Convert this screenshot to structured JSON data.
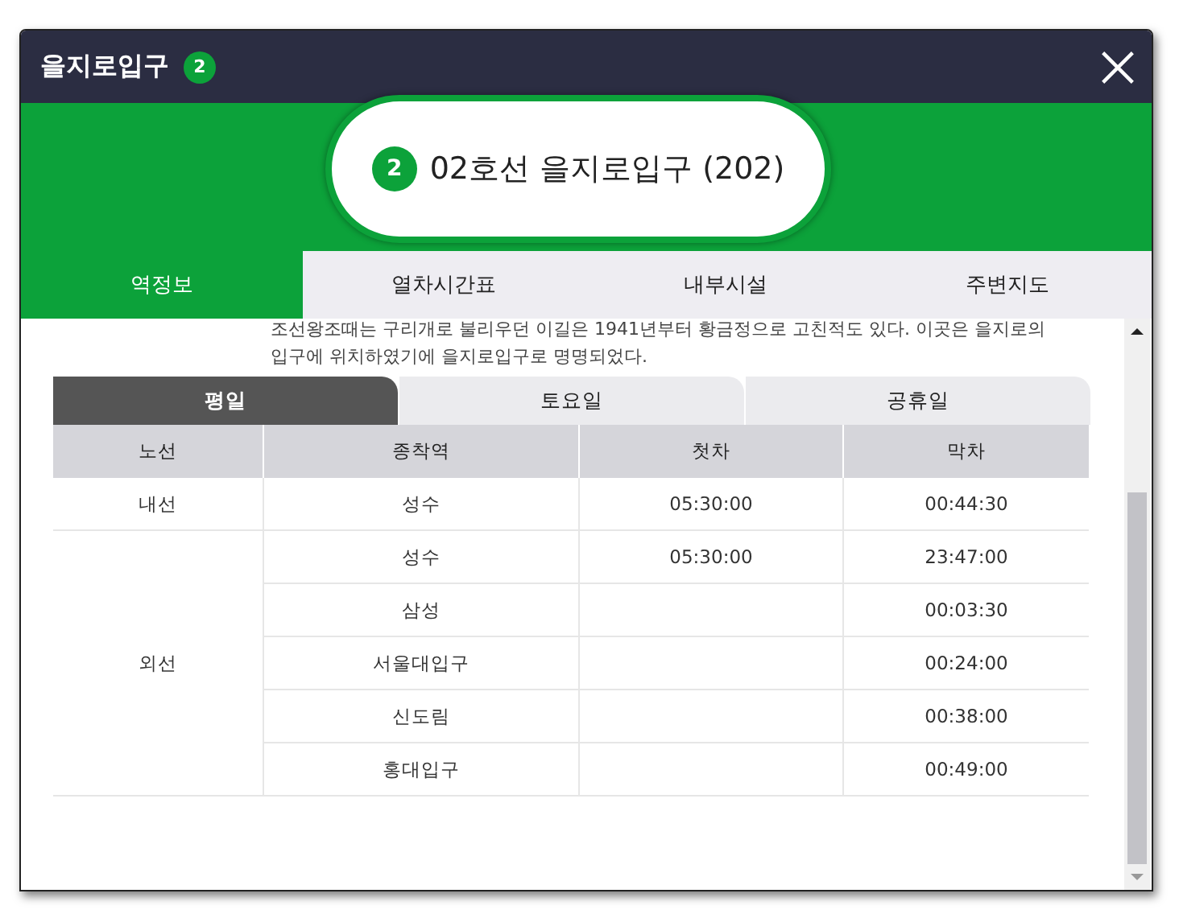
{
  "window": {
    "title": "을지로입구",
    "line_badge": "2"
  },
  "station": {
    "line_badge": "2",
    "name": "02호선 을지로입구 (202)"
  },
  "tabs": [
    {
      "label": "역정보",
      "selected": true
    },
    {
      "label": "열차시간표",
      "selected": false
    },
    {
      "label": "내부시설",
      "selected": false
    },
    {
      "label": "주변지도",
      "selected": false
    }
  ],
  "description": [
    "조선왕조때는 구리개로 불리우던 이길은 1941년부터 황금정으로 고친적도 있다. 이곳은 을지로의",
    "입구에 위치하였기에 을지로입구로 명명되었다."
  ],
  "day_tabs": [
    {
      "label": "평일",
      "selected": true
    },
    {
      "label": "토요일",
      "selected": false
    },
    {
      "label": "공휴일",
      "selected": false
    }
  ],
  "table": {
    "columns": [
      "노선",
      "종착역",
      "첫차",
      "막차"
    ],
    "groups": [
      {
        "line": "내선",
        "rows": [
          {
            "terminal": "성수",
            "first": "05:30:00",
            "last": "00:44:30"
          }
        ]
      },
      {
        "line": "외선",
        "rows": [
          {
            "terminal": "성수",
            "first": "05:30:00",
            "last": "23:47:00"
          },
          {
            "terminal": "삼성",
            "last": "00:03:30"
          },
          {
            "terminal": "서울대입구",
            "last": "00:24:00"
          },
          {
            "terminal": "신도림",
            "last": "00:38:00"
          },
          {
            "terminal": "홍대입구",
            "last": "00:49:00"
          }
        ]
      }
    ]
  }
}
